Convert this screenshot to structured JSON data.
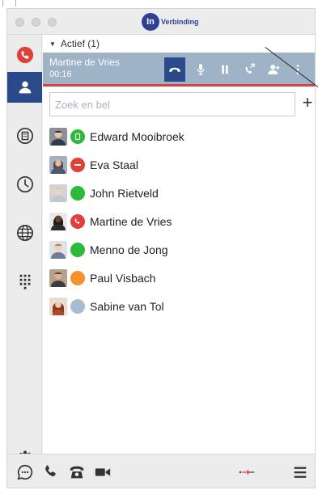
{
  "window": {
    "logo_mark": "In",
    "logo_text": "Verbinding"
  },
  "sidebar": {
    "items": [
      {
        "name": "phone-badge",
        "icon": "phone-icon"
      },
      {
        "name": "contacts",
        "icon": "person-icon",
        "active": true
      },
      {
        "name": "company",
        "icon": "building-icon"
      },
      {
        "name": "history",
        "icon": "clock-icon"
      },
      {
        "name": "web",
        "icon": "globe-icon"
      },
      {
        "name": "dialpad",
        "icon": "dialpad-icon"
      }
    ],
    "settings_icon": "gear-icon"
  },
  "active_section": {
    "label": "Actief (1)"
  },
  "active_call": {
    "name": "Martine de Vries",
    "duration": "00:16"
  },
  "search": {
    "placeholder": "Zoek en bel",
    "value": ""
  },
  "add_label": "+",
  "contacts": [
    {
      "name": "Edward Mooibroek",
      "status": "available-busy",
      "status_color": "#2dba3a"
    },
    {
      "name": "Eva Staal",
      "status": "do-not-disturb",
      "status_color": "#e0403a"
    },
    {
      "name": "John Rietveld",
      "status": "available",
      "status_color": "#2dba3a"
    },
    {
      "name": "Martine de Vries",
      "status": "in-call",
      "status_color": "#e0403a"
    },
    {
      "name": "Menno de Jong",
      "status": "available",
      "status_color": "#2dba3a"
    },
    {
      "name": "Paul Visbach",
      "status": "away",
      "status_color": "#f5922b"
    },
    {
      "name": "Sabine van Tol",
      "status": "offline",
      "status_color": "#a9bccd"
    }
  ],
  "colors": {
    "accent": "#2b4a8c",
    "callbar": "#9fb3c7",
    "alert": "#d64545"
  }
}
